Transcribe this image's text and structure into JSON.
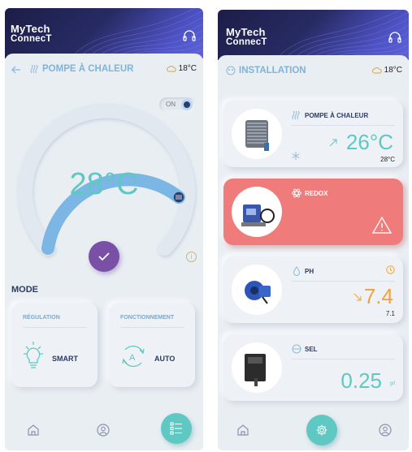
{
  "brand": {
    "line1": "MyTech",
    "line2": "ConnecT"
  },
  "colors": {
    "accent_teal": "#5fc8c2",
    "accent_blue": "#7fb3d9",
    "alert_red": "#f07b7b",
    "confirm_purple": "#7a4fa6",
    "navy": "#2c3a66"
  },
  "screen1": {
    "title": "POMPE À CHALEUR",
    "weather": "18°C",
    "toggle_label": "ON",
    "toggle_on": true,
    "setpoint": "28°C",
    "mode_title": "MODE",
    "regulation": {
      "title": "RÉGULATION",
      "value": "SMART"
    },
    "fonctionnement": {
      "title": "FONCTIONNEMENT",
      "value": "AUTO"
    },
    "icons": [
      "back-arrow-icon",
      "heat-icon",
      "cloud-icon",
      "check-icon",
      "info-icon",
      "lightbulb-icon",
      "auto-cycle-icon",
      "home-icon",
      "user-icon",
      "list-icon"
    ],
    "active_nav": "list"
  },
  "screen2": {
    "title": "INSTALLATION",
    "weather": "18°C",
    "devices": [
      {
        "name": "POMPE À CHALEUR",
        "value": "26°C",
        "sub": "28°C",
        "trend": "up",
        "status": "ok"
      },
      {
        "name": "REDOX",
        "value": "",
        "sub": "",
        "status": "alert"
      },
      {
        "name": "PH",
        "value": "7.4",
        "sub": "7.1",
        "trend": "down",
        "status": "ok"
      },
      {
        "name": "SEL",
        "value": "0.25",
        "unit": "g/l",
        "status": "ok"
      }
    ],
    "icons": [
      "installation-icon",
      "cloud-icon",
      "heat-icon",
      "snowflake-icon",
      "atom-icon",
      "warning-icon",
      "drop-icon",
      "clock-icon",
      "salt-icon",
      "home-icon",
      "gear-icon",
      "user-icon"
    ],
    "active_nav": "settings"
  }
}
